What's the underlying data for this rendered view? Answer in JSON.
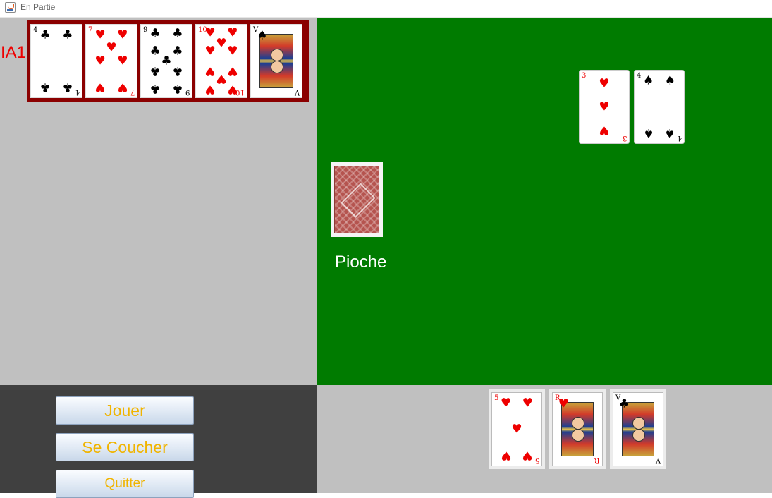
{
  "window": {
    "title": "En Partie"
  },
  "opponent": {
    "name": "IA1",
    "cards": [
      {
        "rank": "4",
        "suit": "♣",
        "color": "black",
        "kind": "pips"
      },
      {
        "rank": "7",
        "suit": "♥",
        "color": "red",
        "kind": "pips"
      },
      {
        "rank": "9",
        "suit": "♣",
        "color": "black",
        "kind": "pips"
      },
      {
        "rank": "10",
        "suit": "♥",
        "color": "red",
        "kind": "pips"
      },
      {
        "rank": "V",
        "suit": "♠",
        "color": "black",
        "kind": "court"
      }
    ]
  },
  "table": {
    "played_cards": [
      {
        "rank": "3",
        "suit": "♥",
        "color": "red",
        "kind": "pips"
      },
      {
        "rank": "4",
        "suit": "♠",
        "color": "black",
        "kind": "pips"
      }
    ],
    "deck_label": "Pioche"
  },
  "controls": {
    "play_label": "Jouer",
    "fold_label": "Se Coucher",
    "quit_label": "Quitter"
  },
  "player": {
    "cards": [
      {
        "rank": "5",
        "suit": "♥",
        "color": "red",
        "kind": "pips"
      },
      {
        "rank": "R",
        "suit": "♥",
        "color": "red",
        "kind": "court"
      },
      {
        "rank": "V",
        "suit": "♣",
        "color": "black",
        "kind": "court"
      }
    ]
  },
  "colors": {
    "table_green": "#007b00",
    "side_gray": "#c0c0c0",
    "controls_dark": "#404040",
    "opponent_frame": "#8b0000",
    "button_text": "#f0b400",
    "opponent_name": "#ee0000"
  }
}
